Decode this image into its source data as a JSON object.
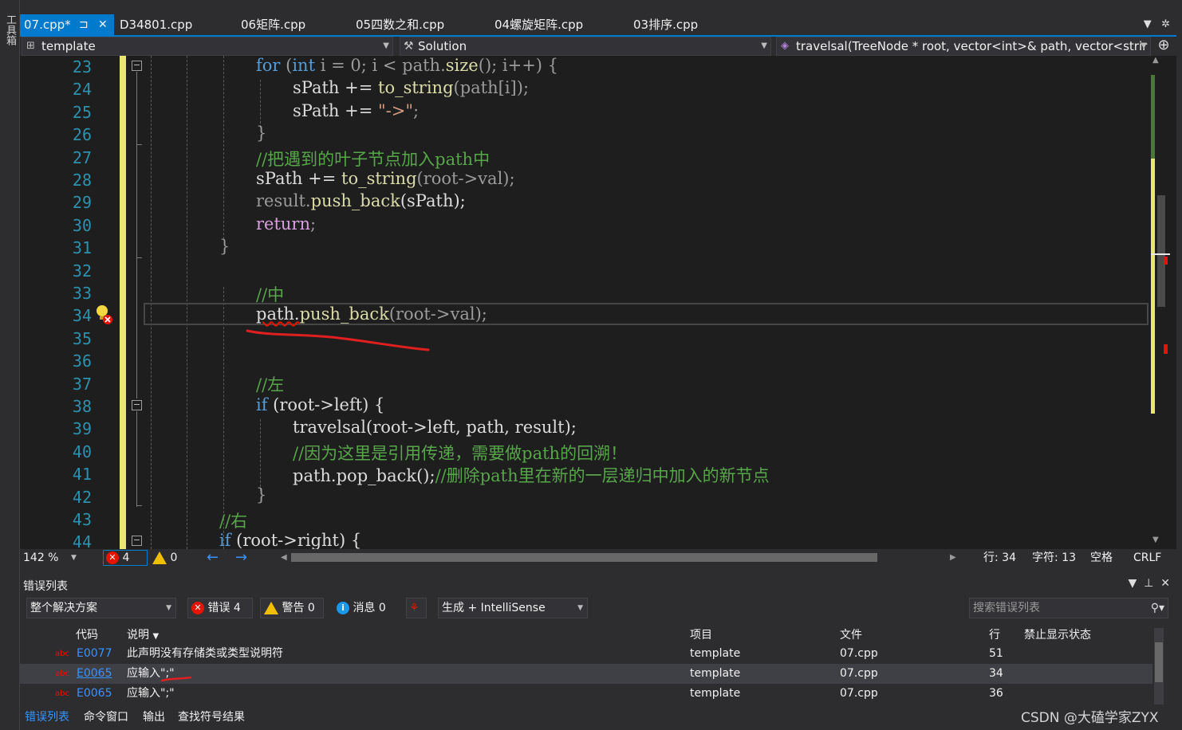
{
  "sidebar": {
    "toolbox_label": "工具箱"
  },
  "tabs": [
    {
      "label": "07.cpp*",
      "active": true
    },
    {
      "label": "D34801.cpp"
    },
    {
      "label": "06矩阵.cpp"
    },
    {
      "label": "05四数之和.cpp"
    },
    {
      "label": "04螺旋矩阵.cpp"
    },
    {
      "label": "03排序.cpp"
    }
  ],
  "tab_icons": {
    "pin": "pin-icon",
    "close": "close-icon",
    "dropdown": "chevron-down-icon",
    "settings": "gear-icon"
  },
  "navbar": {
    "project": "template",
    "scope": "Solution",
    "member": "travelsal(TreeNode * root, vector<int>& path, vector<strir"
  },
  "editor": {
    "line_numbers": [
      "23",
      "24",
      "25",
      "26",
      "27",
      "28",
      "29",
      "30",
      "31",
      "32",
      "33",
      "34",
      "35",
      "36",
      "37",
      "38",
      "39",
      "40",
      "41",
      "42",
      "43",
      "44"
    ],
    "code": {
      "l23a": "for",
      "l23b": " (",
      "l23c": "int",
      "l23d": " i = 0; i < path.",
      "l23e": "size",
      "l23f": "(); i++) {",
      "l24a": "sPath += ",
      "l24b": "to_string",
      "l24c": "(path[i]);",
      "l25a": "sPath += ",
      "l25b": "\"->\"",
      "l25c": ";",
      "l26": "}",
      "l27": "//把遇到的叶子节点加入path中",
      "l28a": "sPath += ",
      "l28b": "to_string",
      "l28c": "(root->val);",
      "l29a": "result.",
      "l29b": "push_back",
      "l29c": "(sPath);",
      "l30a": "return",
      "l30b": ";",
      "l31": "}",
      "l33": "//中",
      "l34a": "path.",
      "l34b": "push_back",
      "l34c": "(root->val);",
      "l37": "//左",
      "l38a": "if",
      "l38b": " (root->left) {",
      "l39a": "travelsal",
      "l39b": "(root->left, path, result);",
      "l40": "//因为这里是引用传递，需要做path的回溯！",
      "l41a": "path.",
      "l41b": "pop_back",
      "l41c": "();",
      "l41d": "//删除path里在新的一层递归中加入的新节点",
      "l42": "}",
      "l43": "//右",
      "l44a": "if",
      "l44b": " (root->right) {"
    }
  },
  "statusbar": {
    "zoom": "142 %",
    "errors": "4",
    "warnings": "0",
    "line": "行: 34",
    "char": "字符: 13",
    "spaces": "空格",
    "eol": "CRLF"
  },
  "error_list": {
    "title": "错误列表",
    "scope": "整个解决方案",
    "errors_btn": "错误 4",
    "warnings_btn": "警告 0",
    "messages_btn": "消息 0",
    "build_filter": "生成 + IntelliSense",
    "search_placeholder": "搜索错误列表",
    "columns": {
      "code": "代码",
      "desc": "说明",
      "project": "项目",
      "file": "文件",
      "line": "行",
      "suppress": "禁止显示状态"
    },
    "rows": [
      {
        "code": "E0077",
        "desc": "此声明没有存储类或类型说明符",
        "project": "template",
        "file": "07.cpp",
        "line": "51"
      },
      {
        "code": "E0065",
        "desc": "应输入\";\"",
        "project": "template",
        "file": "07.cpp",
        "line": "34"
      },
      {
        "code": "E0065",
        "desc": "应输入\";\"",
        "project": "template",
        "file": "07.cpp",
        "line": "36"
      }
    ],
    "bottom_tabs": [
      "错误列表",
      "命令窗口",
      "输出",
      "查找符号结果"
    ]
  },
  "watermark": "CSDN @大磕学家ZYX",
  "colors": {
    "accent": "#007acc",
    "error": "#e51400",
    "warning": "#f0c000",
    "comment": "#57a64a",
    "keyword": "#569cd6"
  }
}
